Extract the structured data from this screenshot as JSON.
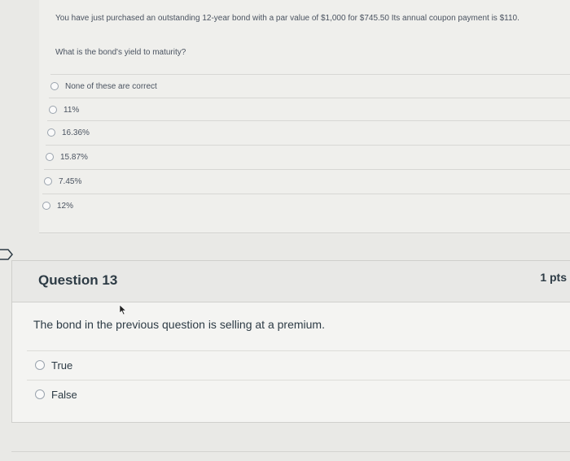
{
  "question12": {
    "text": "You have just purchased an outstanding 12-year bond with a par value of $1,000 for $745.50 Its annual coupon payment is $110.",
    "prompt": "What is the bond's yield to maturity?",
    "options": [
      "None of these are correct",
      "11%",
      "16.36%",
      "15.87%",
      "7.45%",
      "12%"
    ]
  },
  "question13": {
    "title": "Question 13",
    "points": "1 pts",
    "text": "The bond in the previous question is selling at a premium.",
    "options": [
      "True",
      "False"
    ]
  }
}
